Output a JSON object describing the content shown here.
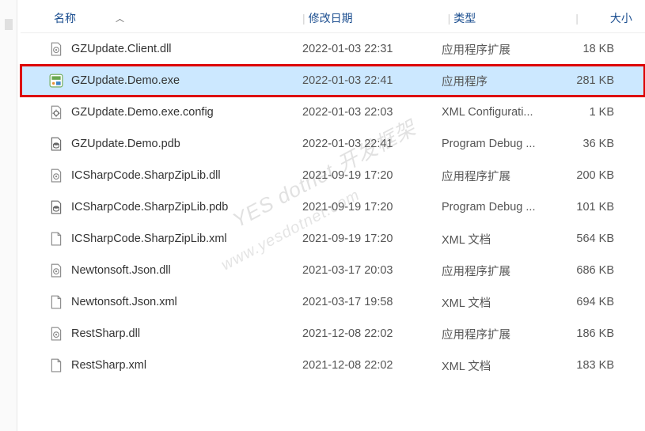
{
  "columns": {
    "name": "名称",
    "date": "修改日期",
    "type": "类型",
    "size": "大小"
  },
  "watermark": {
    "line1": "YES dotnet 开发框架",
    "line2": "www.yesdotnet.com"
  },
  "files": [
    {
      "icon": "dll",
      "name": "GZUpdate.Client.dll",
      "date": "2022-01-03 22:31",
      "type": "应用程序扩展",
      "size": "18 KB",
      "selected": false,
      "highlighted": false
    },
    {
      "icon": "exe",
      "name": "GZUpdate.Demo.exe",
      "date": "2022-01-03 22:41",
      "type": "应用程序",
      "size": "281 KB",
      "selected": true,
      "highlighted": true
    },
    {
      "icon": "config",
      "name": "GZUpdate.Demo.exe.config",
      "date": "2022-01-03 22:03",
      "type": "XML Configurati...",
      "size": "1 KB",
      "selected": false,
      "highlighted": false
    },
    {
      "icon": "pdb",
      "name": "GZUpdate.Demo.pdb",
      "date": "2022-01-03 22:41",
      "type": "Program Debug ...",
      "size": "36 KB",
      "selected": false,
      "highlighted": false
    },
    {
      "icon": "dll",
      "name": "ICSharpCode.SharpZipLib.dll",
      "date": "2021-09-19 17:20",
      "type": "应用程序扩展",
      "size": "200 KB",
      "selected": false,
      "highlighted": false
    },
    {
      "icon": "pdb",
      "name": "ICSharpCode.SharpZipLib.pdb",
      "date": "2021-09-19 17:20",
      "type": "Program Debug ...",
      "size": "101 KB",
      "selected": false,
      "highlighted": false
    },
    {
      "icon": "file",
      "name": "ICSharpCode.SharpZipLib.xml",
      "date": "2021-09-19 17:20",
      "type": "XML 文档",
      "size": "564 KB",
      "selected": false,
      "highlighted": false
    },
    {
      "icon": "dll",
      "name": "Newtonsoft.Json.dll",
      "date": "2021-03-17 20:03",
      "type": "应用程序扩展",
      "size": "686 KB",
      "selected": false,
      "highlighted": false
    },
    {
      "icon": "file",
      "name": "Newtonsoft.Json.xml",
      "date": "2021-03-17 19:58",
      "type": "XML 文档",
      "size": "694 KB",
      "selected": false,
      "highlighted": false
    },
    {
      "icon": "dll",
      "name": "RestSharp.dll",
      "date": "2021-12-08 22:02",
      "type": "应用程序扩展",
      "size": "186 KB",
      "selected": false,
      "highlighted": false
    },
    {
      "icon": "file",
      "name": "RestSharp.xml",
      "date": "2021-12-08 22:02",
      "type": "XML 文档",
      "size": "183 KB",
      "selected": false,
      "highlighted": false
    }
  ]
}
